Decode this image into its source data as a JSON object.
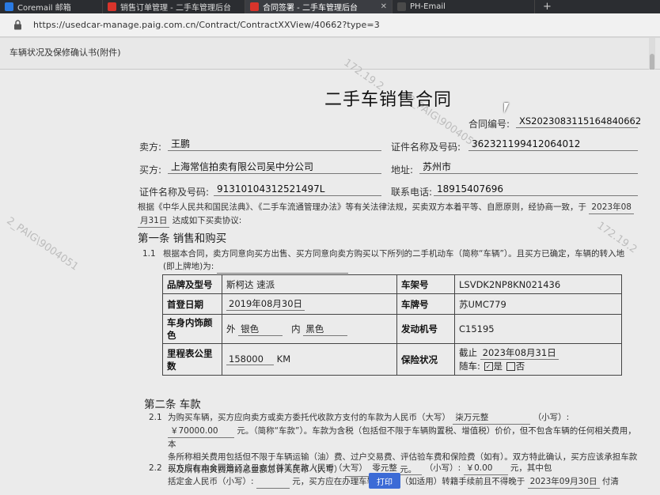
{
  "tabs": [
    {
      "label": "Coremail 邮箱",
      "color": "#2a7ae2"
    },
    {
      "label": "销售订单管理 - 二手车管理后台",
      "color": "#d9342b"
    },
    {
      "label": "合同签署 - 二手车管理后台",
      "color": "#d9342b"
    },
    {
      "label": "PH-Email",
      "color": "#4a4a4a"
    }
  ],
  "address": {
    "url": "https://usedcar-manage.paig.com.cn/Contract/ContractXXView/40662?type=3"
  },
  "subheader": {
    "title": "车辆状况及保修确认书(附件)"
  },
  "watermarks": [
    "172.19.2",
    "2_PAIG\\9004051",
    "172.19.2",
    "2_PAIG\\9004051"
  ],
  "contract": {
    "title": "二手车销售合同",
    "contract_no_label": "合同编号:",
    "contract_no": "XS20230831151648406​62",
    "seller_label": "卖方:",
    "seller": "王鹏",
    "id_label": "证件名称及号码:",
    "seller_id": "362321199412064012",
    "buyer_label": "买方:",
    "buyer": "上海常信拍卖有限公司吴中分公司",
    "address_label": "地址:",
    "buyer_address": "苏州市",
    "buyer_id_label": "证件名称及号码:",
    "buyer_id": "91310104312521497L",
    "phone_label": "联系电话:",
    "buyer_phone": "18915407696",
    "intro_1": "根据《中华人民共和国民法典》、《二手车流通管理办法》等有关法律法规，买卖双方本着平等、自愿原则，经协商一致，于",
    "intro_date": "2023年08",
    "intro_2": "月31日",
    "intro_3": "达成如下买卖协议:",
    "section1": "第一条  销售和购买",
    "clause_1_1_no": "1.1",
    "clause_1_1": "根据本合同，卖方同意向买方出售、买方同意向卖方购买以下所列的二手机动车（简称“车辆”）。且买方已确定，车辆的转入地",
    "clause_1_1b": "(即上牌地)为:",
    "section2": "第二条  车款",
    "clause_2_1_no": "2.1",
    "clause_2_1a": "为购买车辆，买方应向卖方或卖方委托代收款方支付的车款为人民币（大写）",
    "price_upper": "柒万元整",
    "clause_2_1b": "（小写）:",
    "price_lower": "￥70000.00",
    "clause_2_1c": "元。（简称“车款”）。车款为含税（包括但不限于车辆购置税、增值税）价价，但不包含车辆的任何相关费用，本",
    "clause_2_1d": "条所称相关费用包括但不限于车辆运输（油）费、过户交易费、评估验车费和保险费（如有）。双方特此确认，买方应该承担车款",
    "clause_2_1e": "以及所有相关费用的总金额总计人民币（大写）",
    "clause_2_1f": "元。",
    "clause_2_2_no": "2.2",
    "clause_2_2a": "买方应在本合同签订之日支付首笔车款人民币（大写）",
    "first_upper": "零元整",
    "clause_2_2b": "（小写）:",
    "first_lower": "￥0.00",
    "clause_2_2c": "元，其中包",
    "clause_2_2d": "括定金人民币（小写）:",
    "clause_2_2e": "元，买方应在办理车辆过户和（如适用）转籍手续前且不得晚于",
    "deadline": "2023年09月30日",
    "clause_2_2f": "付清"
  },
  "vehicle": {
    "brand_label": "品牌及型号",
    "brand": "斯柯达 速派",
    "vin_label": "车架号",
    "vin": "LSVDK2NP8KN021436",
    "reg_label": "首登日期",
    "reg_date": "2019年08月30日",
    "plate_label": "车牌号",
    "plate": "苏UMC779",
    "color_label": "车身内饰颜色",
    "ext_prefix": "外",
    "ext_color": "银色",
    "int_prefix": "内",
    "int_color": "黑色",
    "engine_label": "发动机号",
    "engine": "C15195",
    "mileage_label": "里程表公里数",
    "mileage": "158000",
    "mileage_unit": "KM",
    "insurance_label": "保险状况",
    "ins_prefix": "截止",
    "ins_date": "2023年08月31日",
    "ins_with_car": "随车:",
    "ins_yes": "是",
    "ins_no": "否"
  },
  "print_button": {
    "label": "打印"
  }
}
